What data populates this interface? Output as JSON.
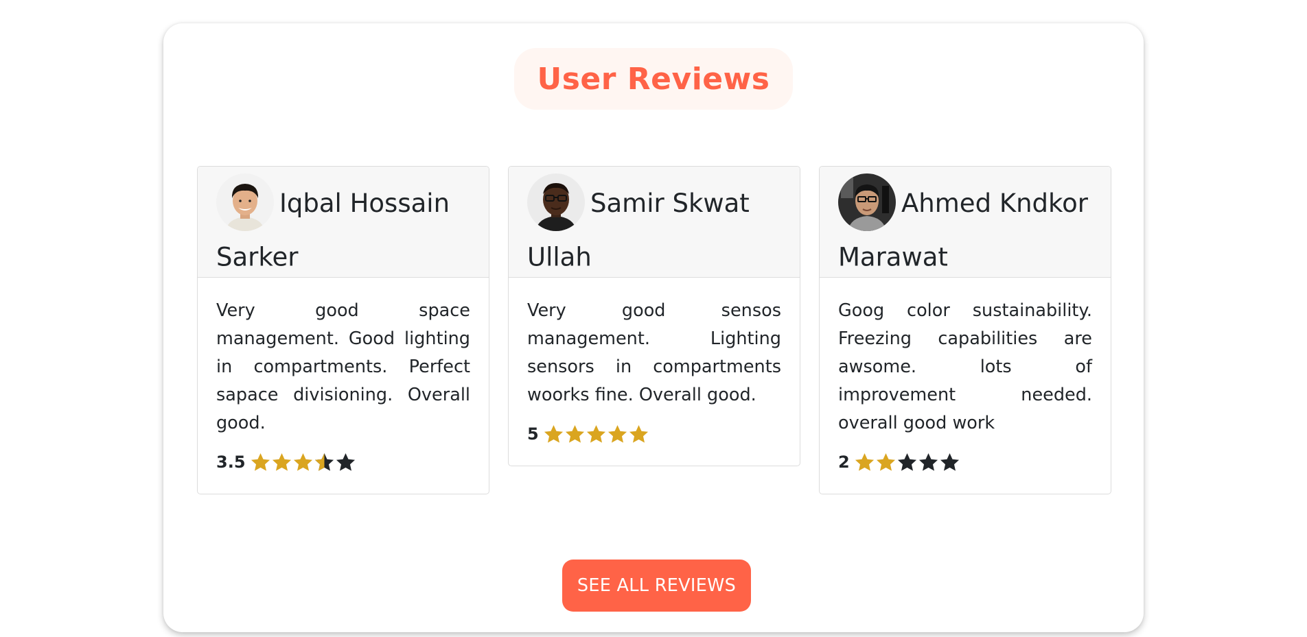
{
  "section": {
    "title": "User Reviews",
    "title_color": "#ff6347",
    "title_bg": "#fff6f2"
  },
  "reviews": [
    {
      "name": "Iqbal Hossain Sarker",
      "avatar_icon": "user-photo",
      "text": "Very good space management. Good lighting in compartments. Perfect sapace divisioning. Overall good.",
      "rating_label": "3.5",
      "rating": 3.5,
      "max_rating": 5
    },
    {
      "name": "Samir Skwat Ullah",
      "avatar_icon": "user-photo",
      "text": "Very good sensos management. Lighting sensors in compartments woorks fine. Overall good.",
      "rating_label": "5",
      "rating": 5,
      "max_rating": 5
    },
    {
      "name": "Ahmed Kndkor Marawat",
      "avatar_icon": "user-photo",
      "text": "Goog color sustainability. Freezing capabilities are awsome. lots of improvement needed. overall good work",
      "rating_label": "2",
      "rating": 2,
      "max_rating": 5
    }
  ],
  "cta": {
    "label": "SEE ALL REVIEWS",
    "bg_color": "#ff6347"
  },
  "colors": {
    "star_filled": "#daa520",
    "star_empty": "#212529"
  }
}
